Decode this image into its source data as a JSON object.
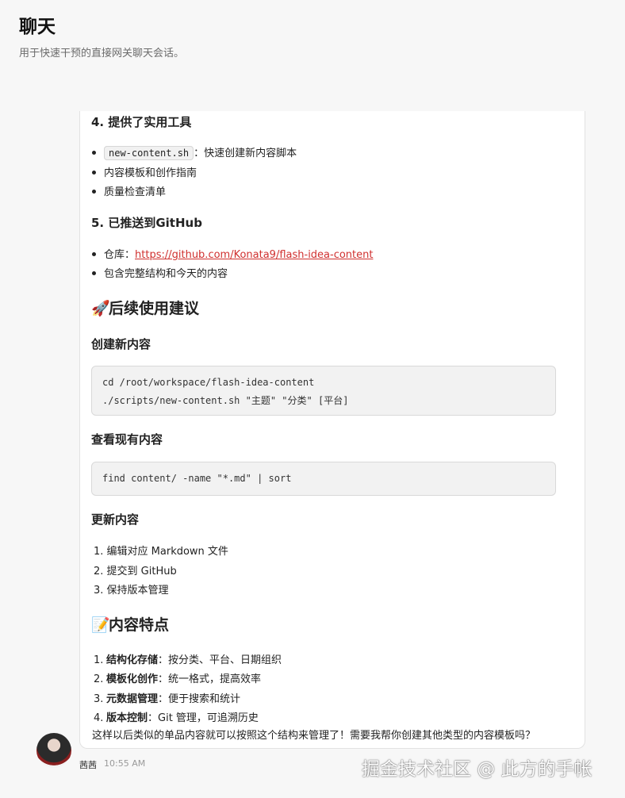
{
  "header": {
    "title": "聊天",
    "subtitle": "用于快速干预的直接网关聊天会话。"
  },
  "message": {
    "section4": {
      "title": "4. 提供了实用工具",
      "items": [
        {
          "code": "new-content.sh",
          "text": "：快速创建新内容脚本"
        },
        {
          "text": "内容模板和创作指南"
        },
        {
          "text": "质量检查清单"
        }
      ]
    },
    "section5": {
      "title": "5. 已推送到GitHub",
      "repo_label": "仓库：",
      "repo_link": "https://github.com/Konata9/flash-idea-content",
      "item2": "包含完整结构和今天的内容"
    },
    "usage": {
      "emoji": "🚀",
      "title": "后续使用建议",
      "create": {
        "title": "创建新内容",
        "code": [
          "cd /root/workspace/flash-idea-content",
          "./scripts/new-content.sh \"主题\" \"分类\" [平台]"
        ]
      },
      "view": {
        "title": "查看现有内容",
        "code": [
          "find content/ -name \"*.md\" | sort"
        ]
      },
      "update": {
        "title": "更新内容",
        "steps": [
          "1. 编辑对应 Markdown 文件",
          "2. 提交到 GitHub",
          "3. 保持版本管理"
        ]
      }
    },
    "features": {
      "emoji": "📝",
      "title": "内容特点",
      "items": [
        {
          "num": "1.",
          "bold": "结构化存储",
          "text": "：按分类、平台、日期组织"
        },
        {
          "num": "2.",
          "bold": "模板化创作",
          "text": "：统一格式，提高效率"
        },
        {
          "num": "3.",
          "bold": "元数据管理",
          "text": "：便于搜索和统计"
        },
        {
          "num": "4.",
          "bold": "版本控制",
          "text": "：Git 管理，可追溯历史"
        }
      ]
    },
    "closing": "这样以后类似的单品内容就可以按照这个结构来管理了！需要我帮你创建其他类型的内容模板吗？"
  },
  "meta": {
    "sender": "茜茜",
    "time": "10:55 AM",
    "avatar_icon": "user-avatar-icon"
  },
  "watermark": "掘金技术社区 @ 此方的手帐"
}
